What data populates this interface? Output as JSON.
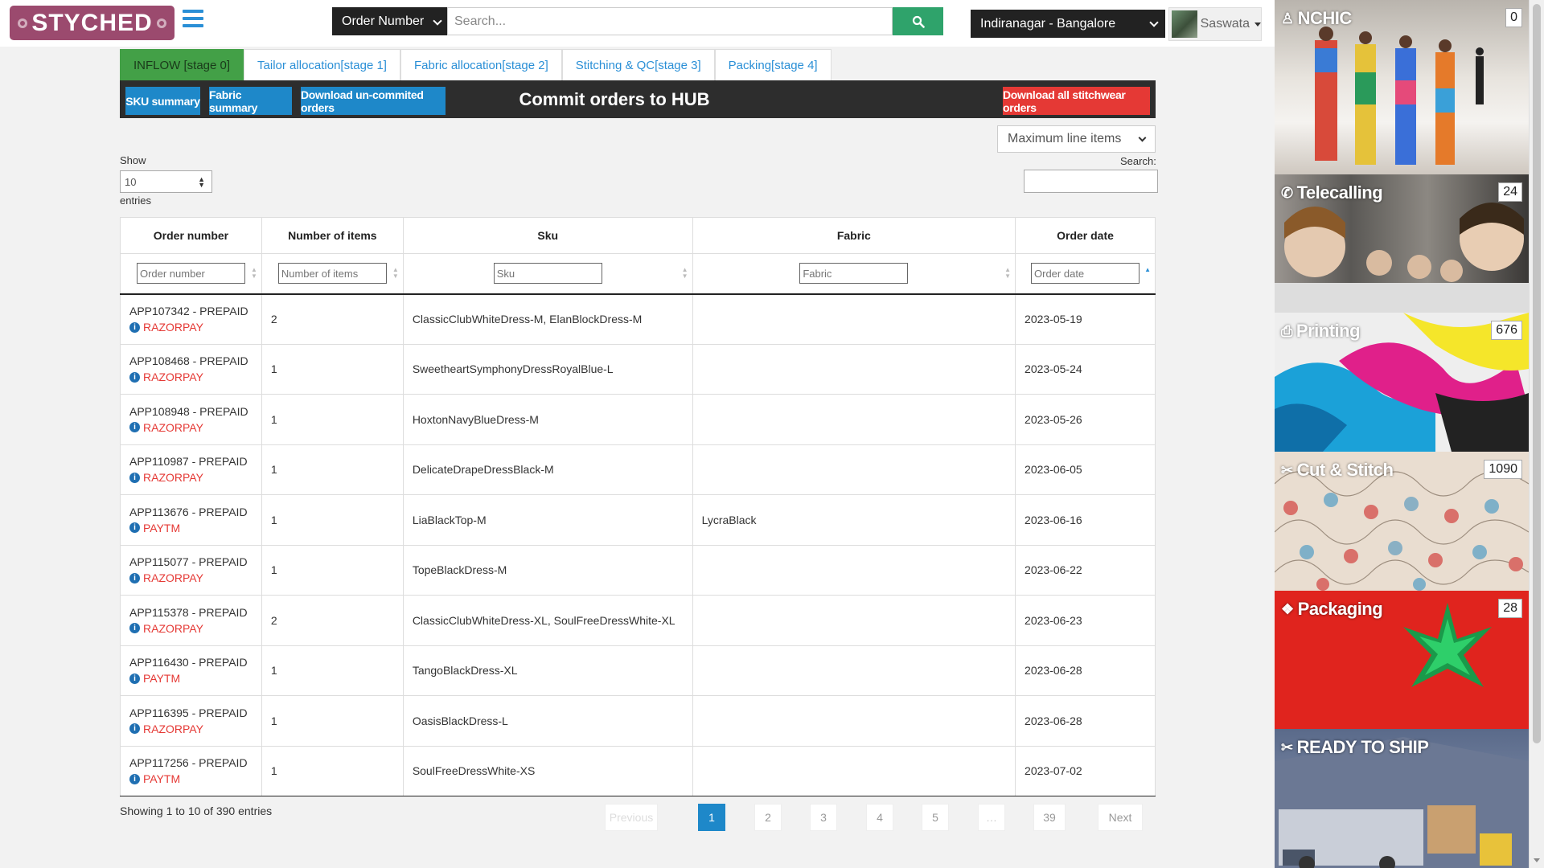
{
  "header": {
    "logo_text": "STYCHED",
    "search_type": "Order Number",
    "search_placeholder": "Search...",
    "location": "Indiranagar - Bangalore",
    "user_name": "Saswata"
  },
  "tabs": [
    {
      "label": "INFLOW [stage 0]",
      "active": true
    },
    {
      "label": "Tailor allocation[stage 1]",
      "active": false
    },
    {
      "label": "Fabric allocation[stage 2]",
      "active": false
    },
    {
      "label": "Stitching & QC[stage 3]",
      "active": false
    },
    {
      "label": "Packing[stage 4]",
      "active": false
    }
  ],
  "toolbar": {
    "sku_summary": "SKU summary",
    "fabric_summary": "Fabric summary",
    "download_uncommitted": "Download un-commited orders",
    "title": "Commit orders to HUB",
    "download_all": "Download all stitchwear orders"
  },
  "filters": {
    "max_line_items": "Maximum line items",
    "show_label": "Show",
    "show_value": "10",
    "entries_label": "entries",
    "search_label": "Search:"
  },
  "table": {
    "columns": [
      "Order number",
      "Number of items",
      "Sku",
      "Fabric",
      "Order date"
    ],
    "filter_placeholders": [
      "Order number",
      "Number of items",
      "Sku",
      "Fabric",
      "Order date"
    ],
    "rows": [
      {
        "order": "APP107342 - PREPAID",
        "payment": "RAZORPAY",
        "items": "2",
        "sku": "ClassicClubWhiteDress-M, ElanBlockDress-M",
        "fabric": "",
        "date": "2023-05-19"
      },
      {
        "order": "APP108468 - PREPAID",
        "payment": "RAZORPAY",
        "items": "1",
        "sku": "SweetheartSymphonyDressRoyalBlue-L",
        "fabric": "",
        "date": "2023-05-24"
      },
      {
        "order": "APP108948 - PREPAID",
        "payment": "RAZORPAY",
        "items": "1",
        "sku": "HoxtonNavyBlueDress-M",
        "fabric": "",
        "date": "2023-05-26"
      },
      {
        "order": "APP110987 - PREPAID",
        "payment": "RAZORPAY",
        "items": "1",
        "sku": "DelicateDrapeDressBlack-M",
        "fabric": "",
        "date": "2023-06-05"
      },
      {
        "order": "APP113676 - PREPAID",
        "payment": "PAYTM",
        "items": "1",
        "sku": "LiaBlackTop-M",
        "fabric": "LycraBlack",
        "date": "2023-06-16"
      },
      {
        "order": "APP115077 - PREPAID",
        "payment": "RAZORPAY",
        "items": "1",
        "sku": "TopeBlackDress-M",
        "fabric": "",
        "date": "2023-06-22"
      },
      {
        "order": "APP115378 - PREPAID",
        "payment": "RAZORPAY",
        "items": "2",
        "sku": "ClassicClubWhiteDress-XL, SoulFreeDressWhite-XL",
        "fabric": "",
        "date": "2023-06-23"
      },
      {
        "order": "APP116430 - PREPAID",
        "payment": "PAYTM",
        "items": "1",
        "sku": "TangoBlackDress-XL",
        "fabric": "",
        "date": "2023-06-28"
      },
      {
        "order": "APP116395 - PREPAID",
        "payment": "RAZORPAY",
        "items": "1",
        "sku": "OasisBlackDress-L",
        "fabric": "",
        "date": "2023-06-28"
      },
      {
        "order": "APP117256 - PREPAID",
        "payment": "PAYTM",
        "items": "1",
        "sku": "SoulFreeDressWhite-XS",
        "fabric": "",
        "date": "2023-07-02"
      }
    ]
  },
  "pagination": {
    "showing": "Showing 1 to 10 of 390 entries",
    "previous": "Previous",
    "next": "Next",
    "pages": [
      "1",
      "2",
      "3",
      "4",
      "5",
      "…",
      "39"
    ],
    "current": "1"
  },
  "sidebar": [
    {
      "label": "NCHIC",
      "count": "0",
      "icon": "user-icon"
    },
    {
      "label": "Telecalling",
      "count": "24",
      "icon": "phone-icon"
    },
    {
      "label": "Printing",
      "count": "676",
      "icon": "print-icon"
    },
    {
      "label": "Cut & Stitch",
      "count": "1090",
      "icon": "scissors-icon"
    },
    {
      "label": "Packaging",
      "count": "28",
      "icon": "cubes-icon"
    },
    {
      "label": "READY TO SHIP",
      "count": "",
      "icon": "scissors-icon"
    }
  ],
  "colors": {
    "brand": "#9b4a6e",
    "active_tab": "#43a047",
    "primary_button": "#1e88c9",
    "danger_button": "#e53935",
    "payment_text": "#e53935"
  }
}
